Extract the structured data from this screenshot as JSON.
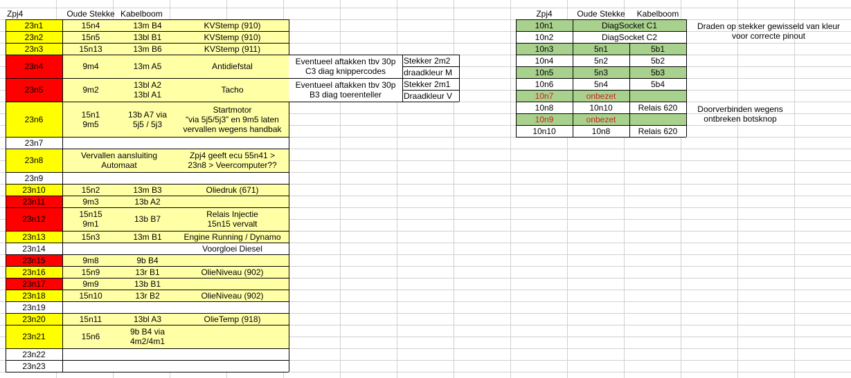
{
  "left_header": [
    "Zpj4",
    "Oude Stekke",
    "Kabelboom"
  ],
  "left_rows": [
    {
      "id": "23n1",
      "c": "y",
      "b": "15n4",
      "c2": "13m B4",
      "d": "KVStemp (910)"
    },
    {
      "id": "23n2",
      "c": "y",
      "b": "15n5",
      "c2": "13bl B1",
      "d": "KVStemp (910)"
    },
    {
      "id": "23n3",
      "c": "y",
      "b": "15n13",
      "c2": "13m B6",
      "d": "KVStemp (911)"
    },
    {
      "id": "23n4",
      "c": "r",
      "b": "9m4",
      "c2": "13m A5",
      "d": "Antidiefstal"
    },
    {
      "id": "23n5",
      "c": "r",
      "b": "9m2",
      "c2": "13bl A2\n13bl A1",
      "d": "Tacho"
    },
    {
      "id": "23n6",
      "c": "y",
      "b": "15n1\n9m5",
      "c2": "13b A7 via\n5j5 / 5j3",
      "d": "Startmotor\n“via 5j5/5j3” en 9m5 laten\nvervallen wegens handbak"
    },
    {
      "id": "23n7",
      "c": "w",
      "b": "",
      "c2": "",
      "d": ""
    },
    {
      "id": "23n8",
      "c": "y",
      "merged": "Vervallen aansluiting\nAutomaat",
      "d": "Zpj4 geeft ecu 55n41 >\n23n8 > Veercomputer??"
    },
    {
      "id": "23n9",
      "c": "w",
      "b": "",
      "c2": "",
      "d": ""
    },
    {
      "id": "23n10",
      "c": "y",
      "b": "15n2",
      "c2": "13m B3",
      "d": "Oliedruk (671)"
    },
    {
      "id": "23n11",
      "c": "r",
      "b": "9m3",
      "c2": "13b A2",
      "d": ""
    },
    {
      "id": "23n12",
      "c": "r",
      "b": "15n15\n9m1",
      "c2": "13b B7",
      "d": "Relais Injectie\n15n15 vervalt"
    },
    {
      "id": "23n13",
      "c": "y",
      "b": "15n3",
      "c2": "13m B1",
      "d": "Engine Running / Dynamo"
    },
    {
      "id": "23n14",
      "c": "w",
      "b": "",
      "c2": "",
      "d": "Voorgloei Diesel"
    },
    {
      "id": "23n15",
      "c": "r",
      "b": "9m8",
      "c2": "9b B4",
      "d": ""
    },
    {
      "id": "23n16",
      "c": "y",
      "b": "15n9",
      "c2": "13r B1",
      "d": "OlieNiveau (902)"
    },
    {
      "id": "23n17",
      "c": "r",
      "b": "9m9",
      "c2": "13b B1",
      "d": ""
    },
    {
      "id": "23n18",
      "c": "y",
      "b": "15n10",
      "c2": "13r B2",
      "d": "OlieNiveau (902)"
    },
    {
      "id": "23n19",
      "c": "w",
      "b": "",
      "c2": "",
      "d": ""
    },
    {
      "id": "23n20",
      "c": "y",
      "b": "15n11",
      "c2": "13bl A3",
      "d": "OlieTemp (918)"
    },
    {
      "id": "23n21",
      "c": "y",
      "b": "15n6",
      "c2": "9b B4 via\n4m2/4m1",
      "d": ""
    },
    {
      "id": "23n22",
      "c": "w",
      "b": "",
      "c2": "",
      "d": ""
    },
    {
      "id": "23n23",
      "c": "w",
      "b": "",
      "c2": "",
      "d": ""
    }
  ],
  "middle_rows": [
    {
      "a": "Eventueel aftakken tbv 30p\nC3 diag knippercodes",
      "b1": "Stekker 2m2",
      "b2": "draadkleur M"
    },
    {
      "a": "Eventueel aftakken tbv 30p\nB3 diag toerenteller",
      "b1": "Stekker 2m1",
      "b2": "Draadkleur V"
    }
  ],
  "right_header": [
    "Zpj4",
    "Oude Stekke",
    "Kabelboom"
  ],
  "right_rows": [
    {
      "id": "10n1",
      "g": true,
      "merged": "DiagSocket C1"
    },
    {
      "id": "10n2",
      "g": false,
      "merged": "DiagSocket C2"
    },
    {
      "id": "10n3",
      "g": true,
      "b": "5n1",
      "c": "5b1"
    },
    {
      "id": "10n4",
      "g": false,
      "b": "5n2",
      "c": "5b2"
    },
    {
      "id": "10n5",
      "g": true,
      "b": "5n3",
      "c": "5b3"
    },
    {
      "id": "10n6",
      "g": false,
      "b": "5n4",
      "c": "5b4"
    },
    {
      "id": "10n7",
      "g": true,
      "red": true,
      "b": "onbezet",
      "c": ""
    },
    {
      "id": "10n8",
      "g": false,
      "b": "10n10",
      "c": "Relais 620"
    },
    {
      "id": "10n9",
      "g": true,
      "red": true,
      "b": "onbezet",
      "c": ""
    },
    {
      "id": "10n10",
      "g": false,
      "b": "10n8",
      "c": "Relais 620"
    }
  ],
  "notes": [
    "Draden op stekker gewisseld van kleur\nvoor correcte pinout",
    "Doorverbinden wegens\nontbreken botsknop"
  ]
}
